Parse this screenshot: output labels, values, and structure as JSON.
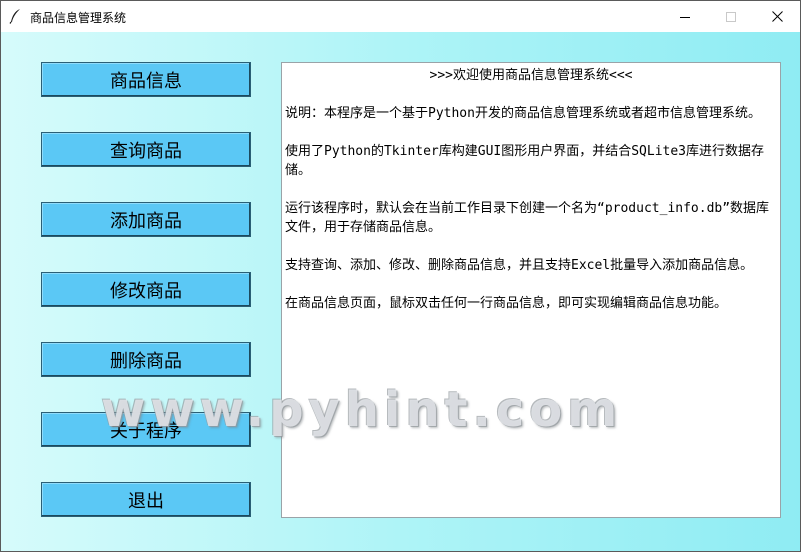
{
  "window": {
    "title": "商品信息管理系统",
    "controls": {
      "minimize": "minimize-icon",
      "maximize": "maximize-icon",
      "close": "close-icon"
    }
  },
  "sidebar": {
    "buttons": [
      {
        "label": "商品信息"
      },
      {
        "label": "查询商品"
      },
      {
        "label": "添加商品"
      },
      {
        "label": "修改商品"
      },
      {
        "label": "删除商品"
      },
      {
        "label": "关于程序"
      },
      {
        "label": "退出"
      }
    ]
  },
  "content": {
    "title": ">>>欢迎使用商品信息管理系统<<<",
    "paragraphs": [
      "说明：本程序是一个基于Python开发的商品信息管理系统或者超市信息管理系统。",
      "使用了Python的Tkinter库构建GUI图形用户界面，并结合SQLite3库进行数据存储。",
      "运行该程序时，默认会在当前工作目录下创建一个名为“product_info.db”数据库文件，用于存储商品信息。",
      "支持查询、添加、修改、删除商品信息，并且支持Excel批量导入添加商品信息。",
      "在商品信息页面，鼠标双击任何一行商品信息，即可实现编辑商品信息功能。"
    ]
  },
  "watermark": {
    "text": "www.pyhint.com"
  },
  "colors": {
    "button_fill": "#5bc8f5",
    "background_left": "#d6fbfb",
    "background_right": "#8fecf3"
  }
}
